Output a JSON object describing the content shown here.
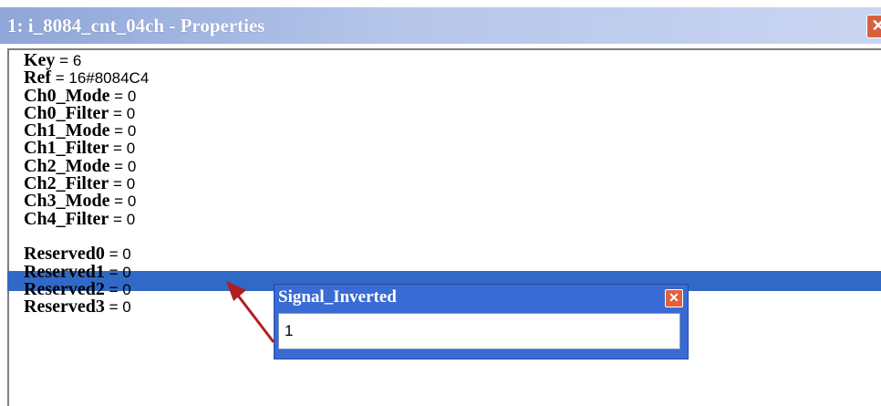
{
  "window": {
    "title": "1: i_8084_cnt_04ch - Properties",
    "close_glyph": "✕"
  },
  "properties": [
    {
      "name": "Key",
      "eq": " = ",
      "value": "6"
    },
    {
      "name": "Ref",
      "eq": " = ",
      "value": "16#8084C4"
    },
    {
      "name": "Ch0_Mode",
      "eq": " = ",
      "value": "0"
    },
    {
      "name": "Ch0_Filter",
      "eq": " = ",
      "value": "0"
    },
    {
      "name": "Ch1_Mode",
      "eq": " = ",
      "value": "0"
    },
    {
      "name": "Ch1_Filter",
      "eq": " = ",
      "value": "0"
    },
    {
      "name": "Ch2_Mode",
      "eq": " = ",
      "value": "0"
    },
    {
      "name": "Ch2_Filter",
      "eq": " = ",
      "value": "0"
    },
    {
      "name": "Ch3_Mode",
      "eq": " = ",
      "value": "0"
    },
    {
      "name": "Ch4_Filter",
      "eq": " = ",
      "value": "0"
    },
    {
      "name": "Signal_Inverted",
      "eq": " = ",
      "value": "1"
    },
    {
      "name": "Reserved0",
      "eq": " = ",
      "value": "0"
    },
    {
      "name": "Reserved1",
      "eq": " = ",
      "value": "0"
    },
    {
      "name": "Reserved2",
      "eq": " = ",
      "value": "0"
    },
    {
      "name": "Reserved3",
      "eq": " = ",
      "value": "0"
    }
  ],
  "selected_index": 10,
  "popup": {
    "title": "Signal_Inverted",
    "value": "1",
    "close_glyph": "✕"
  },
  "colors": {
    "selection": "#3169c6",
    "arrow": "#b01e1e"
  }
}
